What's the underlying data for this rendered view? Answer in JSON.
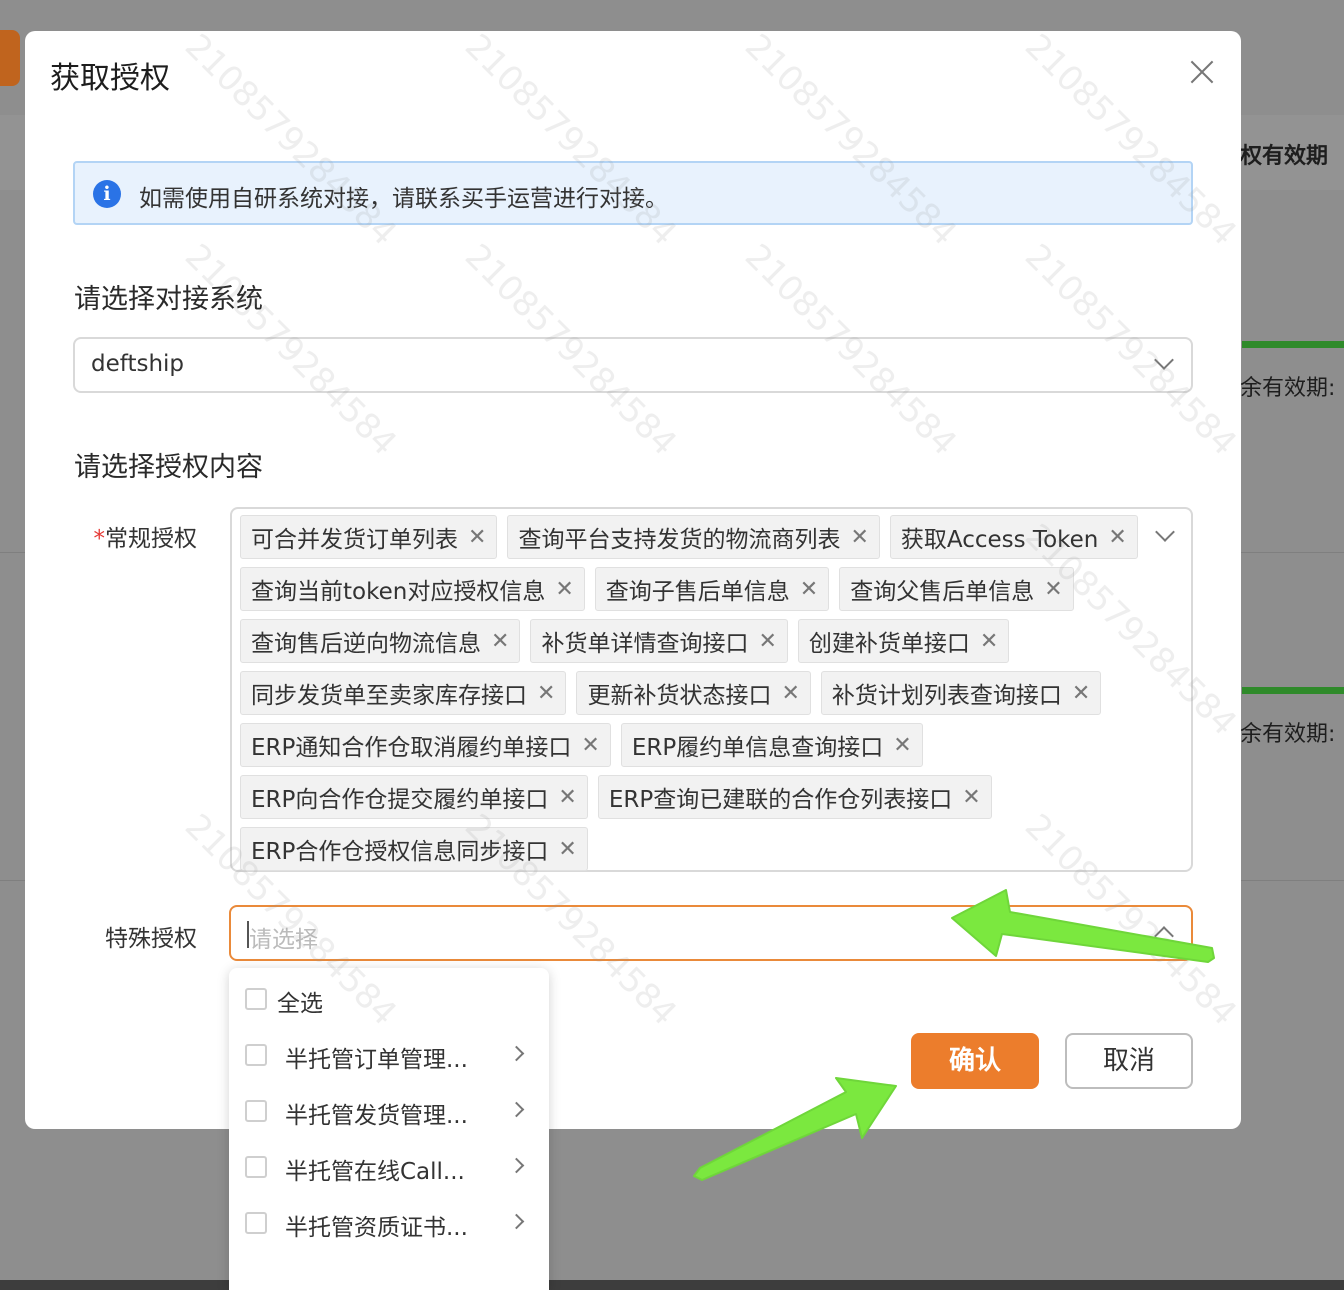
{
  "modal": {
    "title": "获取授权",
    "notice": "如需使用自研系统对接，请联系买手运营进行对接。",
    "system_section_label": "请选择对接系统",
    "system_value": "deftship",
    "content_section_label": "请选择授权内容",
    "regular_label_required": "*",
    "regular_label": "常规授权",
    "regular_tags": [
      "可合并发货订单列表",
      "查询平台支持发货的物流商列表",
      "获取Access Token",
      "查询当前token对应授权信息",
      "查询子售后单信息",
      "查询父售后单信息",
      "查询售后逆向物流信息",
      "补货单详情查询接口",
      "创建补货单接口",
      "同步发货单至卖家库存接口",
      "更新补货状态接口",
      "补货计划列表查询接口",
      "ERP通知合作仓取消履约单接口",
      "ERP履约单信息查询接口",
      "ERP向合作仓提交履约单接口",
      "ERP查询已建联的合作仓列表接口",
      "ERP合作仓授权信息同步接口"
    ],
    "special_label": "特殊授权",
    "special_placeholder": "请选择",
    "confirm_label": "确认",
    "cancel_label": "取消"
  },
  "dropdown": {
    "select_all": "全选",
    "items": [
      "半托管订单管理...",
      "半托管发货管理...",
      "半托管在线Call...",
      "半托管资质证书..."
    ]
  },
  "background": {
    "header_text": "权有效期",
    "row1_text": "余有效期:",
    "row2_text": "余有效期:"
  },
  "watermark": "2108579284584",
  "colors": {
    "accent": "#ec7d2c",
    "info": "#2a73e6",
    "arrow": "#7be83f"
  }
}
